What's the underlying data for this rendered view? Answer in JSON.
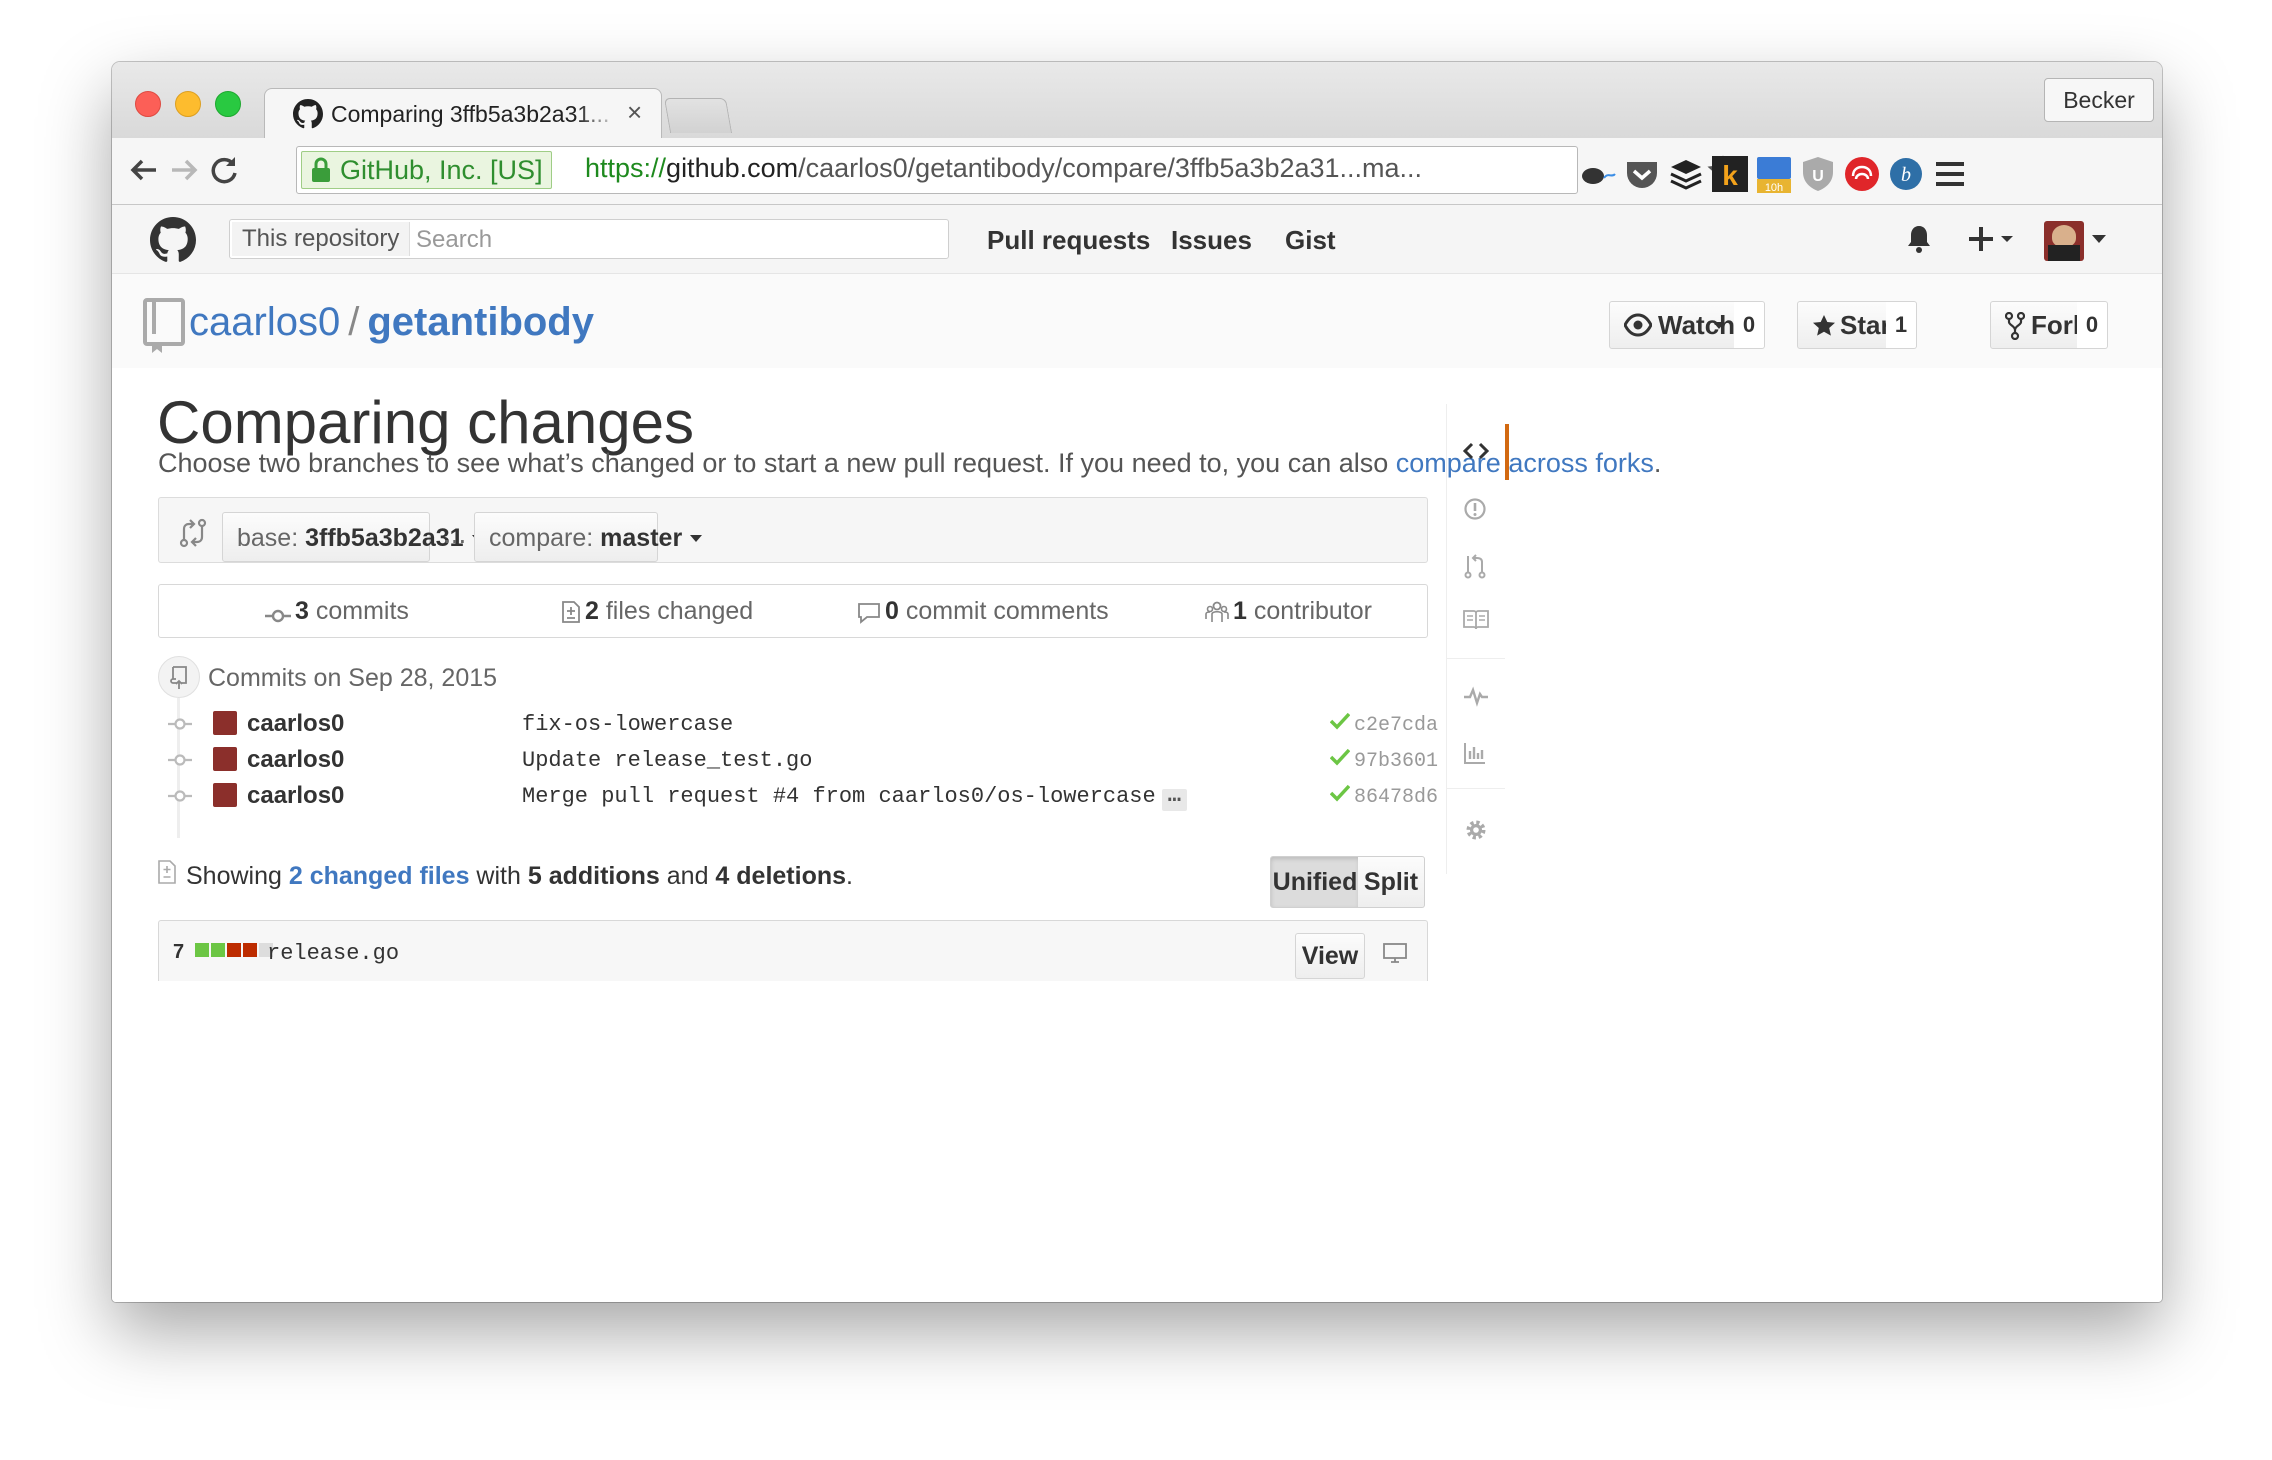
{
  "browser": {
    "tab_title": "Comparing 3ffb5a3b2a31...",
    "profile_name": "Becker",
    "ev_label": "GitHub, Inc. [US]",
    "url_scheme": "https://",
    "url_host": "github.com",
    "url_path": "/caarlos0/getantibody/compare/3ffb5a3b2a31...ma...",
    "extension_badge": "10h"
  },
  "header": {
    "scope_label": "This repository",
    "search_placeholder": "Search",
    "nav": [
      "Pull requests",
      "Issues",
      "Gist"
    ]
  },
  "repo": {
    "owner": "caarlos0",
    "separator": "/",
    "name": "getantibody",
    "watch_label": "Watch",
    "watch_count": "0",
    "star_label": "Star",
    "star_count": "1",
    "fork_label": "Fork",
    "fork_count": "0"
  },
  "compare": {
    "title": "Comparing changes",
    "description": "Choose two branches to see what’s changed or to start a new pull request. If you need to, you can also ",
    "description_link": "compare across forks",
    "description_end": ".",
    "base_prefix": "base: ",
    "base_value": "3ffb5a3b2a31",
    "range_separator": "...",
    "compare_prefix": "compare: ",
    "compare_value": "master"
  },
  "numbers": [
    {
      "count": "3",
      "label": "commits",
      "icon": "commit-icon"
    },
    {
      "count": "2",
      "label": "files changed",
      "icon": "file-diff-icon"
    },
    {
      "count": "0",
      "label": "commit comments",
      "icon": "comment-icon"
    },
    {
      "count": "1",
      "label": "contributor",
      "icon": "organization-icon"
    }
  ],
  "commits_group": {
    "title": "Commits on Sep 28, 2015",
    "commits": [
      {
        "author": "caarlos0",
        "message": "fix-os-lowercase",
        "sha": "c2e7cda",
        "status": "success"
      },
      {
        "author": "caarlos0",
        "message": "Update release_test.go",
        "sha": "97b3601",
        "status": "success"
      },
      {
        "author": "caarlos0",
        "message": "Merge pull request #4 from caarlos0/os-lowercase",
        "sha": "86478d6",
        "status": "success",
        "more": "…"
      }
    ]
  },
  "toc": {
    "prefix": "Showing ",
    "files_link": "2 changed files",
    "with": " with ",
    "additions": "5 additions",
    "and": " and ",
    "deletions": "4 deletions",
    "end": ".",
    "unified_label": "Unified",
    "split_label": "Split"
  },
  "file": {
    "count": "7",
    "name": "release.go",
    "view_label": "View",
    "diffstat": [
      "added",
      "added",
      "deleted",
      "deleted",
      "neutral"
    ]
  },
  "colors": {
    "link": "#4078c0",
    "addition": "#6cc644",
    "deletion": "#bd2c00",
    "success": "#6cc644",
    "active_nav": "#d26911"
  }
}
